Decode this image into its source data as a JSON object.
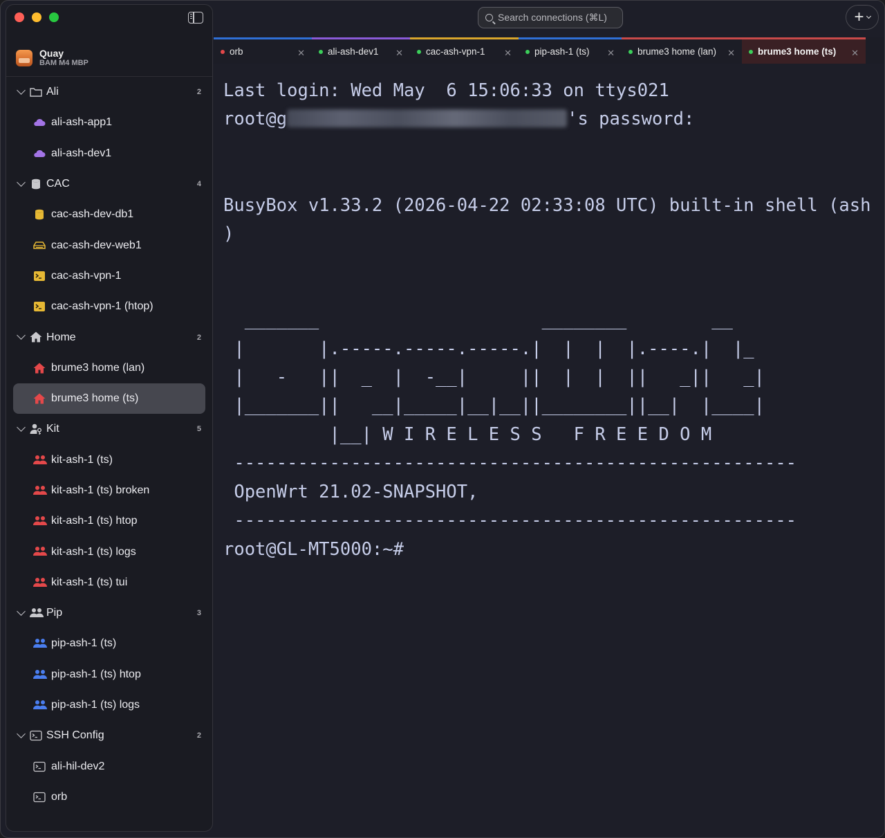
{
  "app": {
    "name": "Quay",
    "subtitle": "BAM M4 MBP"
  },
  "search": {
    "placeholder": "Search connections (⌘L)"
  },
  "toolbar": {
    "new_label": "+"
  },
  "colors": {
    "accent_active_tab": "#c94a4a",
    "sidebar_bg": "#1a1b22",
    "terminal_bg": "#1d1e28",
    "terminal_fg": "#c6cde9"
  },
  "sidebar": {
    "groups": [
      {
        "label": "Ali",
        "count": "2",
        "icon": "folder-icon",
        "items": [
          {
            "label": "ali-ash-app1",
            "icon": "cloud-icon",
            "color": "#a374e6"
          },
          {
            "label": "ali-ash-dev1",
            "icon": "cloud-icon",
            "color": "#a374e6"
          }
        ]
      },
      {
        "label": "CAC",
        "count": "4",
        "icon": "database-icon",
        "items": [
          {
            "label": "cac-ash-dev-db1",
            "icon": "database-icon",
            "color": "#e6b834"
          },
          {
            "label": "cac-ash-dev-web1",
            "icon": "server-icon",
            "color": "#e6b834"
          },
          {
            "label": "cac-ash-vpn-1",
            "icon": "terminal-icon",
            "color": "#e6b834"
          },
          {
            "label": "cac-ash-vpn-1 (htop)",
            "icon": "terminal-icon",
            "color": "#e6b834"
          }
        ]
      },
      {
        "label": "Home",
        "count": "2",
        "icon": "house-icon",
        "items": [
          {
            "label": "brume3 home (lan)",
            "icon": "house-icon",
            "color": "#e4484a"
          },
          {
            "label": "brume3 home (ts)",
            "icon": "house-icon",
            "color": "#e4484a",
            "active": true
          }
        ]
      },
      {
        "label": "Kit",
        "count": "5",
        "icon": "person-key-icon",
        "items": [
          {
            "label": "kit-ash-1 (ts)",
            "icon": "people-icon",
            "color": "#e4484a"
          },
          {
            "label": "kit-ash-1 (ts) broken",
            "icon": "people-icon",
            "color": "#e4484a"
          },
          {
            "label": "kit-ash-1 (ts) htop",
            "icon": "people-icon",
            "color": "#e4484a"
          },
          {
            "label": "kit-ash-1 (ts) logs",
            "icon": "people-icon",
            "color": "#e4484a"
          },
          {
            "label": "kit-ash-1 (ts) tui",
            "icon": "people-icon",
            "color": "#e4484a"
          }
        ]
      },
      {
        "label": "Pip",
        "count": "3",
        "icon": "people-icon",
        "items": [
          {
            "label": "pip-ash-1 (ts)",
            "icon": "people-icon",
            "color": "#4a7ef0"
          },
          {
            "label": "pip-ash-1 (ts) htop",
            "icon": "people-icon",
            "color": "#4a7ef0"
          },
          {
            "label": "pip-ash-1 (ts) logs",
            "icon": "people-icon",
            "color": "#4a7ef0"
          }
        ]
      },
      {
        "label": "SSH Config",
        "count": "2",
        "icon": "terminal-outline-icon",
        "items": [
          {
            "label": "ali-hil-dev2",
            "icon": "terminal-outline-icon",
            "color": "#c8c8cc"
          },
          {
            "label": "orb",
            "icon": "terminal-outline-icon",
            "color": "#c8c8cc"
          }
        ]
      }
    ]
  },
  "tabs": [
    {
      "label": "orb",
      "dot": "#e4484a",
      "bar": "#2f6fd6"
    },
    {
      "label": "ali-ash-dev1",
      "dot": "#3ccf5a",
      "bar": "#8a5ad8"
    },
    {
      "label": "cac-ash-vpn-1",
      "dot": "#3ccf5a",
      "bar": "#d9a62c"
    },
    {
      "label": "pip-ash-1 (ts)",
      "dot": "#3ccf5a",
      "bar": "#2f6fd6"
    },
    {
      "label": "brume3 home (lan)",
      "dot": "#3ccf5a",
      "bar": "#c94a4a"
    },
    {
      "label": "brume3 home (ts)",
      "dot": "#3ccf5a",
      "bar": "#c94a4a",
      "active": true
    }
  ],
  "terminal": {
    "line1": "Last login: Wed May  6 15:06:33 on ttys021",
    "line2_prefix": "root@g",
    "line2_suffix": "'s password:",
    "busybox1": "BusyBox v1.33.2 (2026-04-22 02:33:08 UTC) built-in shell (ash",
    "busybox2": ")",
    "banner": [
      "  _______                     ________        __",
      " |       |.-----.-----.-----.|  |  |  |.----.|  |_",
      " |   -   ||  _  |  -__|     ||  |  |  ||   _||   _|",
      " |_______||   __|_____|__|__||________||__|  |____|",
      "          |__| W I R E L E S S   F R E E D O M",
      " -----------------------------------------------------",
      " OpenWrt 21.02-SNAPSHOT,",
      " -----------------------------------------------------"
    ],
    "prompt": "root@GL-MT5000:~#"
  }
}
